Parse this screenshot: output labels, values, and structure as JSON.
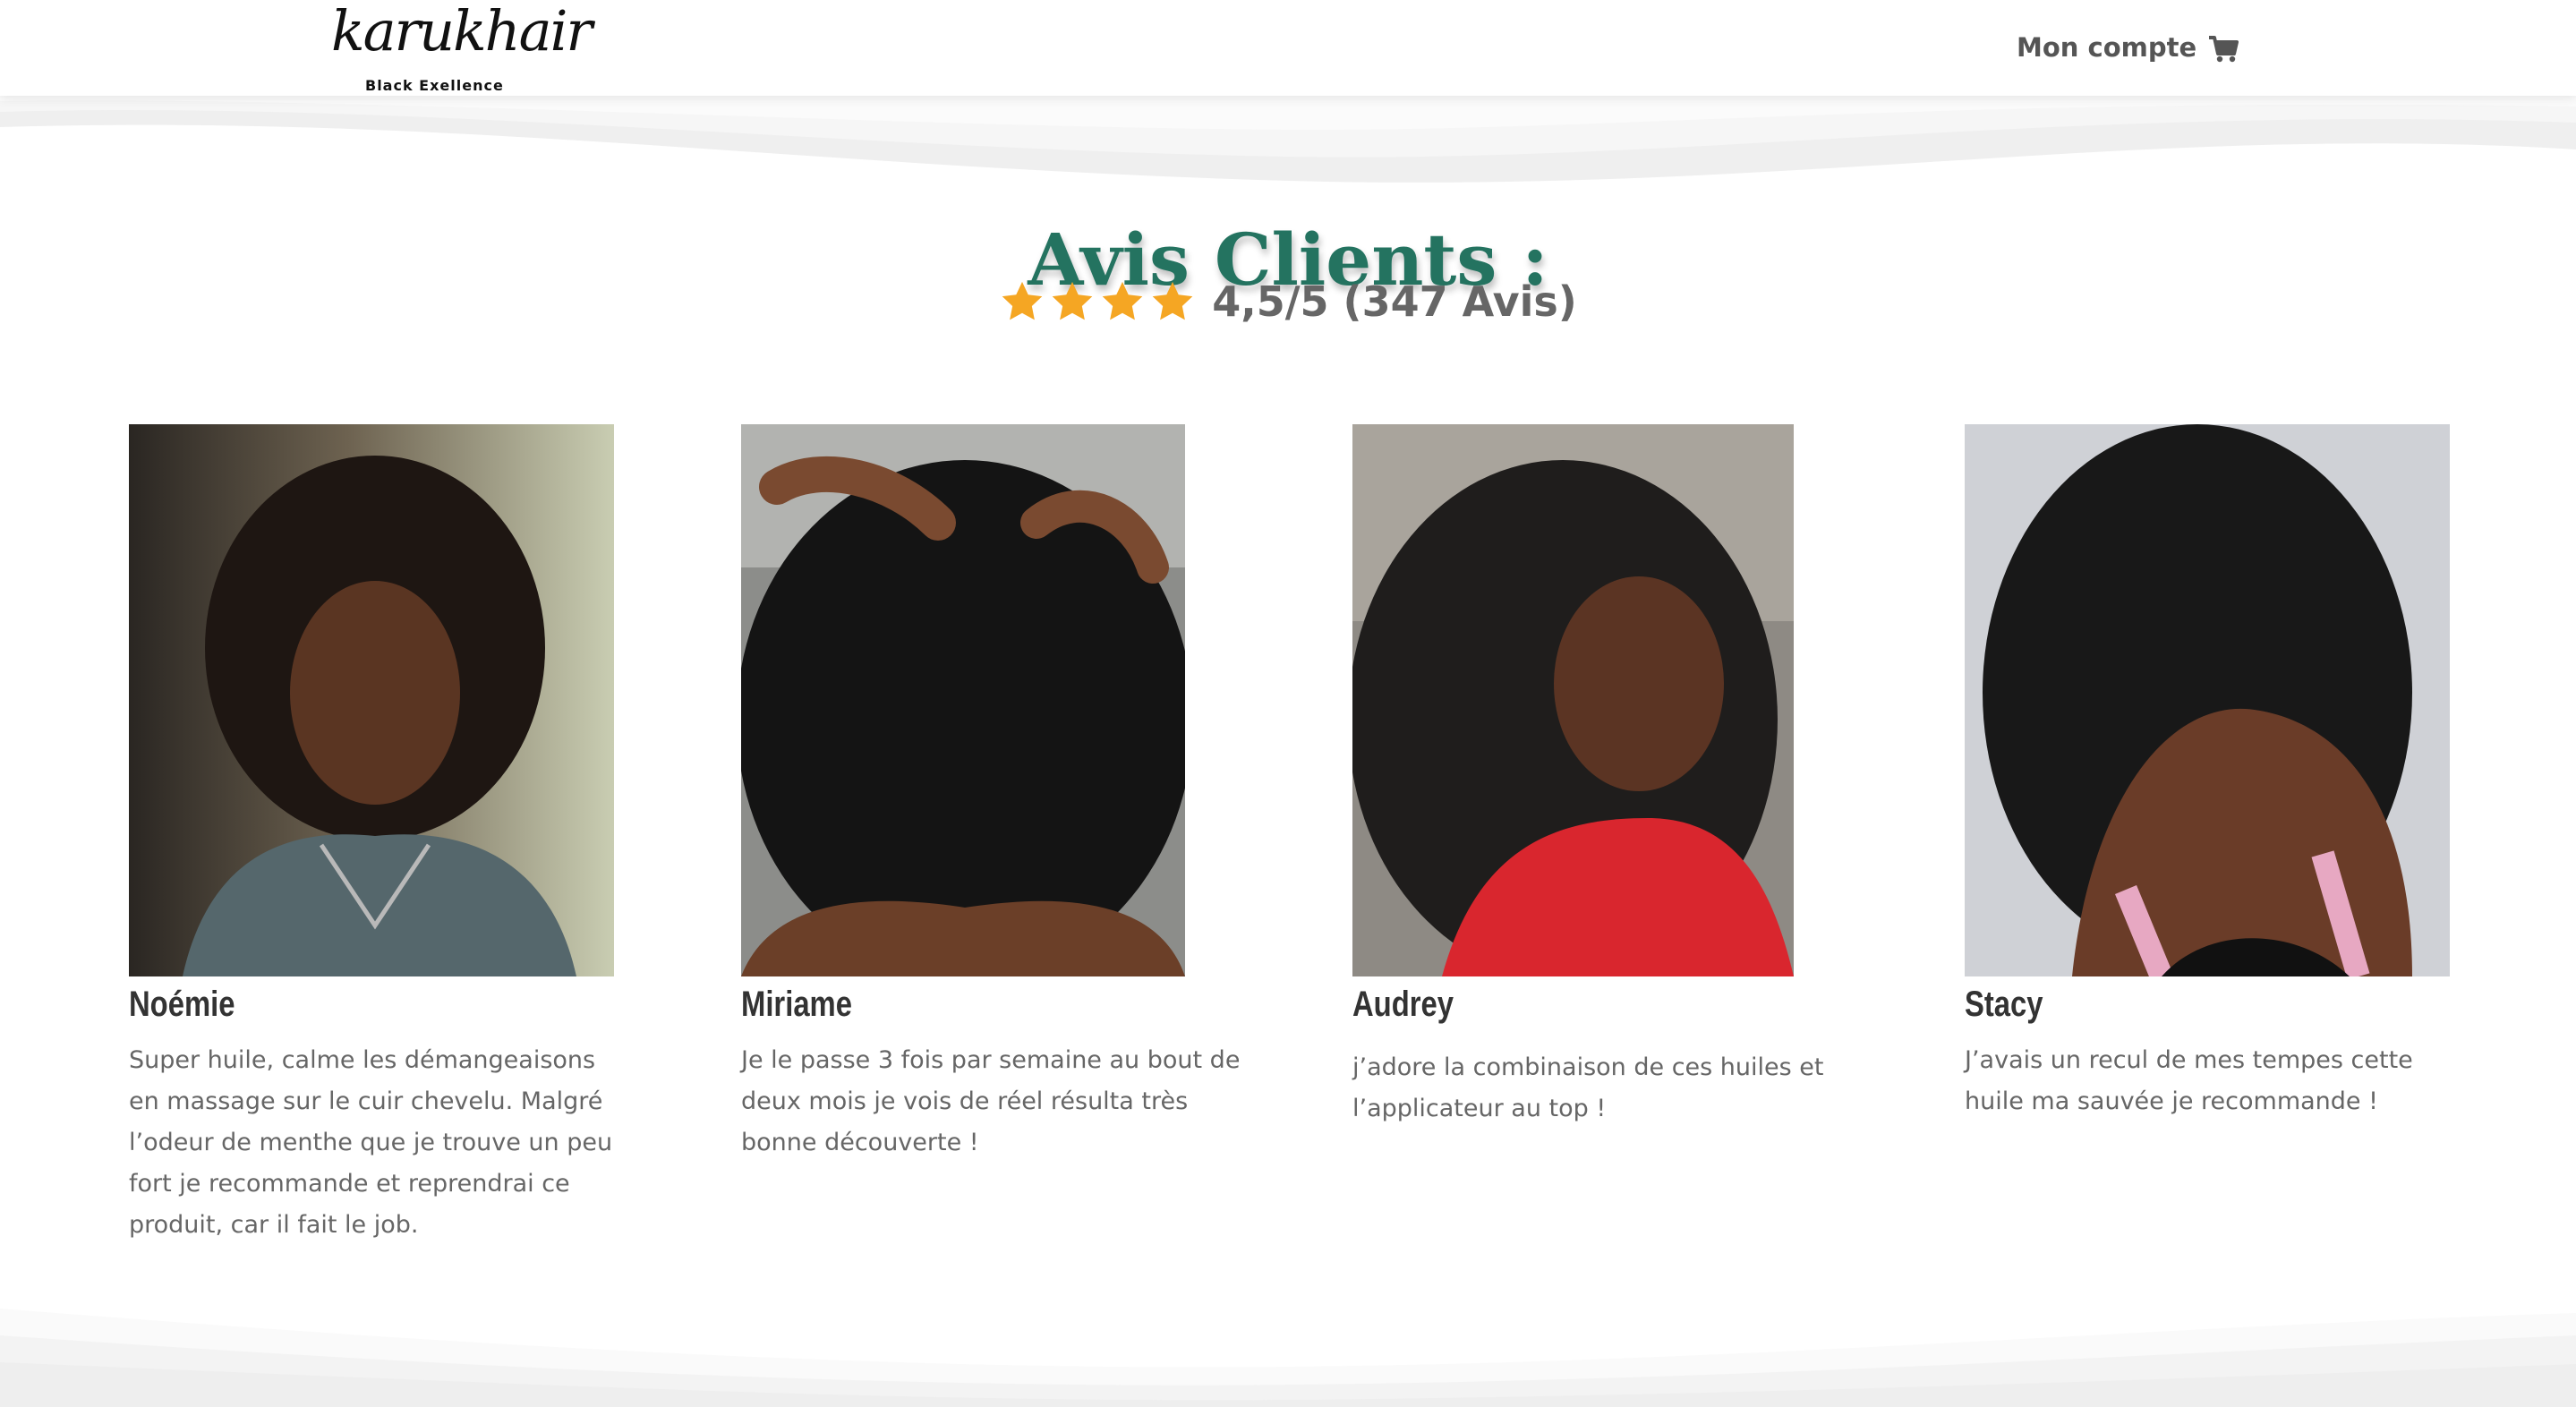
{
  "header": {
    "logo_script": "karukhair",
    "logo_tagline": "Black Exellence",
    "account_label": "Mon compte",
    "cart_icon": "cart-icon"
  },
  "section": {
    "title": "Avis Clients :",
    "rating": {
      "stars": 4,
      "star_color": "#f5a623",
      "text": "4,5/5 (347 Avis)"
    }
  },
  "reviews": [
    {
      "name": "Noémie",
      "text": "Super huile, calme les démangeaisons en massage sur le cuir chevelu. Malgré l’odeur de menthe que je trouve un peu fort je recommande et reprendrai ce produit, car il fait le job."
    },
    {
      "name": "Miriame",
      "text": "Je le passe 3 fois par semaine au bout de deux mois je vois de réel résulta très bonne découverte !"
    },
    {
      "name": "Audrey",
      "text": "j’adore la combinaison de ces huiles et l’applicateur au top !"
    },
    {
      "name": "Stacy",
      "text": "J’avais un recul de mes tempes cette huile ma sauvée je recommande !"
    }
  ],
  "colors": {
    "accent": "#247360",
    "star": "#f5a623",
    "body_text": "#666666",
    "name_text": "#333333",
    "nav_text": "#555555"
  }
}
